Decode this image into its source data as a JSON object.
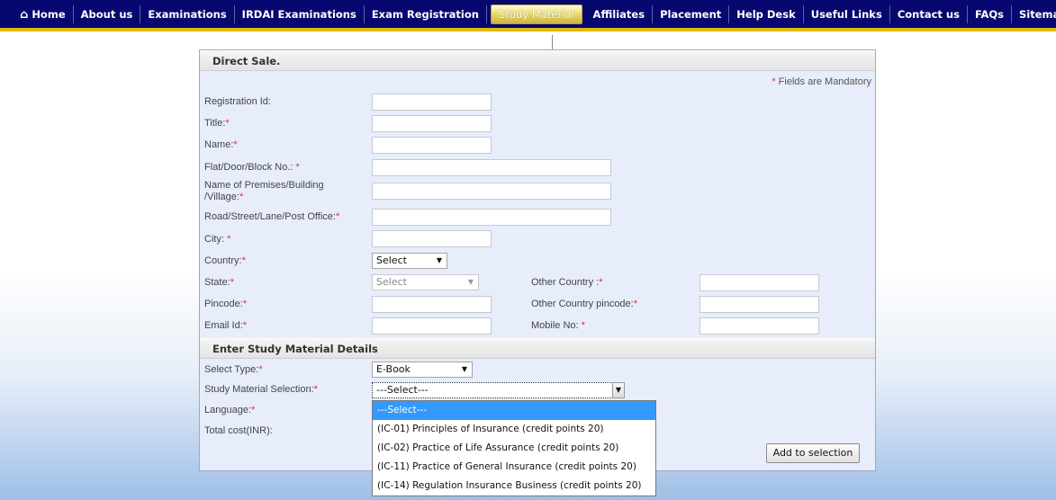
{
  "nav": {
    "items": [
      {
        "label": "Home"
      },
      {
        "label": "About us"
      },
      {
        "label": "Examinations"
      },
      {
        "label": "IRDAI Examinations"
      },
      {
        "label": "Exam Registration"
      },
      {
        "label": "Study Material"
      },
      {
        "label": "Affiliates"
      },
      {
        "label": "Placement"
      },
      {
        "label": "Help Desk"
      },
      {
        "label": "Useful Links"
      },
      {
        "label": "Contact us"
      },
      {
        "label": "FAQs"
      },
      {
        "label": "Sitemap"
      }
    ],
    "active": "Study Material",
    "colors": {
      "bar": "#07086f",
      "underline": "#e1b90a"
    }
  },
  "form": {
    "title": "Direct Sale.",
    "mandatory_note": "Fields are Mandatory",
    "star": "*",
    "fields": {
      "registration_id": {
        "label": "Registration Id:"
      },
      "title": {
        "label": "Title:"
      },
      "name": {
        "label": "Name:"
      },
      "flat": {
        "label": "Flat/Door/Block No.: "
      },
      "premises": {
        "label": "Name of Premises/Building /Village:"
      },
      "road": {
        "label": "Road/Street/Lane/Post Office:"
      },
      "city": {
        "label": "City: "
      },
      "country": {
        "label": "Country:",
        "value": "Select"
      },
      "state": {
        "label": "State:",
        "value": "Select"
      },
      "other_country": {
        "label": "Other Country :"
      },
      "pincode": {
        "label": "Pincode:"
      },
      "other_country_pincode": {
        "label": "Other Country pincode:"
      },
      "email": {
        "label": "Email Id:"
      },
      "mobile": {
        "label": "Mobile No: "
      }
    }
  },
  "study": {
    "title": "Enter Study Material Details",
    "select_type": {
      "label": "Select Type:",
      "value": "E-Book"
    },
    "material": {
      "label": "Study Material Selection:",
      "value": "---Select---"
    },
    "language": {
      "label": "Language:"
    },
    "total_cost": {
      "label": "Total cost(INR):"
    },
    "options": [
      "---Select---",
      "(IC-01) Principles of Insurance (credit points 20)",
      "(IC-02) Practice of Life Assurance (credit points 20)",
      "(IC-11) Practice of General Insurance (credit points 20)",
      "(IC-14) Regulation Insurance Business (credit points 20)"
    ],
    "add_button": "Add to selection"
  }
}
